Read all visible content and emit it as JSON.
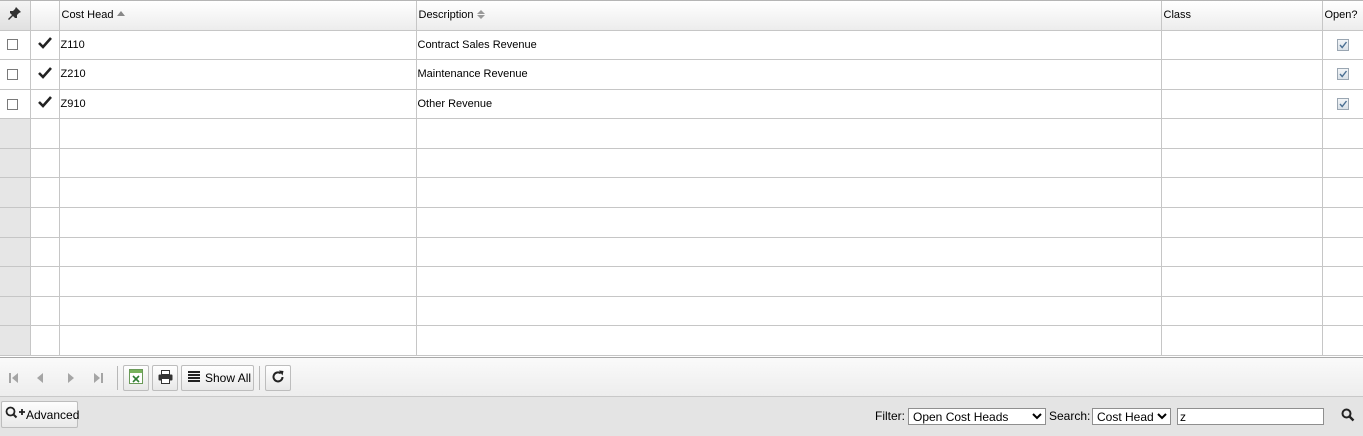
{
  "grid": {
    "columns": {
      "cost_head": "Cost Head",
      "description": "Description",
      "class": "Class",
      "open": "Open?"
    },
    "rows": [
      {
        "cost_head": "Z110",
        "description": "Contract Sales Revenue",
        "class": "",
        "open": true
      },
      {
        "cost_head": "Z210",
        "description": "Maintenance Revenue",
        "class": "",
        "open": true
      },
      {
        "cost_head": "Z910",
        "description": "Other Revenue",
        "class": "",
        "open": true
      }
    ],
    "empty_rows": 8
  },
  "toolbar": {
    "show_all_label": "Show All"
  },
  "bottom": {
    "advanced_label": "Advanced",
    "filter_label": "Filter:",
    "filter_value": "Open Cost Heads",
    "search_label": "Search:",
    "search_field_value": "Cost Head",
    "search_text": "z"
  }
}
